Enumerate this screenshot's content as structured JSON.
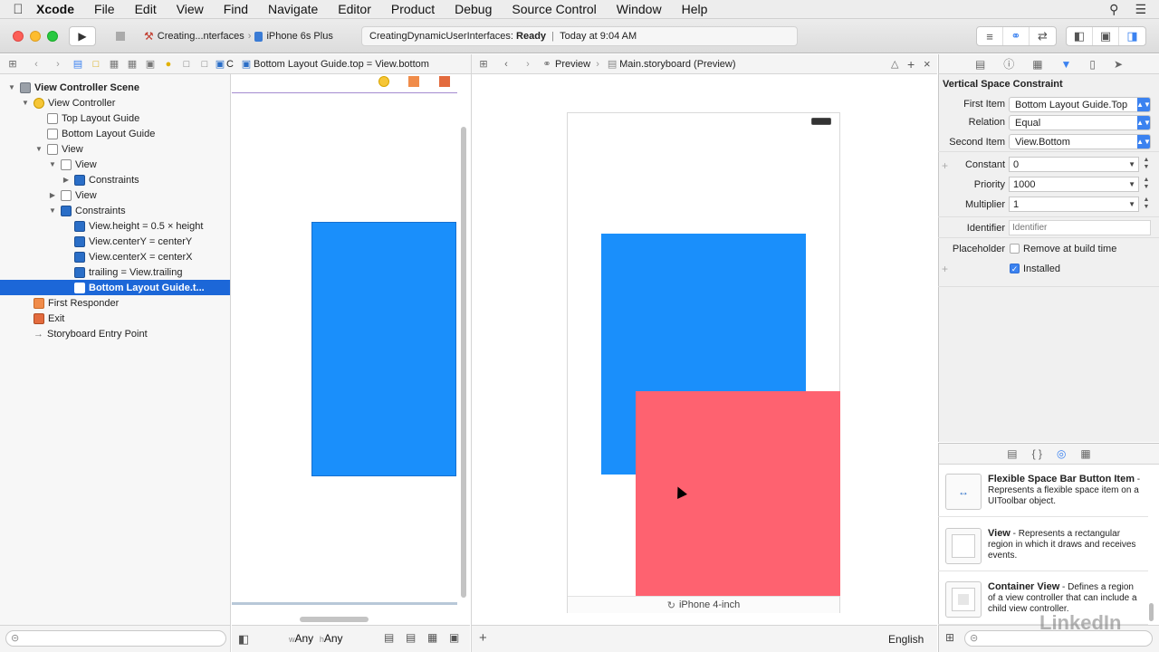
{
  "menubar": {
    "items": [
      "Xcode",
      "File",
      "Edit",
      "View",
      "Find",
      "Navigate",
      "Editor",
      "Product",
      "Debug",
      "Source Control",
      "Window",
      "Help"
    ]
  },
  "toolbar": {
    "scheme_project": "Creating...nterfaces",
    "scheme_device": "iPhone 6s Plus",
    "activity_project": "CreatingDynamicUserInterfaces:",
    "activity_status": "Ready",
    "activity_sep": "|",
    "activity_time": "Today at 9:04 AM"
  },
  "jumpbar": {
    "truncated": "C",
    "path": "Bottom Layout Guide.top = View.bottom"
  },
  "outline": {
    "rows": [
      {
        "label": "View Controller Scene",
        "indent": 0,
        "disc": "▼",
        "icon": "scene",
        "bold": true
      },
      {
        "label": "View Controller",
        "indent": 1,
        "disc": "▼",
        "icon": "vc"
      },
      {
        "label": "Top Layout Guide",
        "indent": 2,
        "disc": "",
        "icon": "plain"
      },
      {
        "label": "Bottom Layout Guide",
        "indent": 2,
        "disc": "",
        "icon": "plain"
      },
      {
        "label": "View",
        "indent": 2,
        "disc": "▼",
        "icon": "plain"
      },
      {
        "label": "View",
        "indent": 3,
        "disc": "▼",
        "icon": "plain"
      },
      {
        "label": "Constraints",
        "indent": 4,
        "disc": "▶",
        "icon": "con"
      },
      {
        "label": "View",
        "indent": 3,
        "disc": "▶",
        "icon": "plain"
      },
      {
        "label": "Constraints",
        "indent": 3,
        "disc": "▼",
        "icon": "con"
      },
      {
        "label": "View.height = 0.5 × height",
        "indent": 4,
        "disc": "",
        "icon": "con"
      },
      {
        "label": "View.centerY = centerY",
        "indent": 4,
        "disc": "",
        "icon": "con"
      },
      {
        "label": "View.centerX = centerX",
        "indent": 4,
        "disc": "",
        "icon": "con"
      },
      {
        "label": "trailing = View.trailing",
        "indent": 4,
        "disc": "",
        "icon": "con"
      },
      {
        "label": "Bottom Layout Guide.t...",
        "indent": 4,
        "disc": "",
        "icon": "con",
        "selected": true
      },
      {
        "label": "First Responder",
        "indent": 1,
        "disc": "",
        "icon": "fr"
      },
      {
        "label": "Exit",
        "indent": 1,
        "disc": "",
        "icon": "red"
      },
      {
        "label": "Storyboard Entry Point",
        "indent": 1,
        "disc": "",
        "icon": "arrow"
      }
    ]
  },
  "preview": {
    "breadcrumb_preview": "Preview",
    "breadcrumb_file": "Main.storyboard (Preview)",
    "device_label": "iPhone 4-inch",
    "language": "English"
  },
  "canvas_bottom": {
    "w_prefix": "w",
    "w_value": "Any",
    "h_prefix": "h",
    "h_value": "Any"
  },
  "inspector": {
    "title": "Vertical Space Constraint",
    "first_item_label": "First Item",
    "first_item_value": "Bottom Layout Guide.Top",
    "relation_label": "Relation",
    "relation_value": "Equal",
    "second_item_label": "Second Item",
    "second_item_value": "View.Bottom",
    "constant_label": "Constant",
    "constant_value": "0",
    "priority_label": "Priority",
    "priority_value": "1000",
    "multiplier_label": "Multiplier",
    "multiplier_value": "1",
    "identifier_label": "Identifier",
    "identifier_placeholder": "Identifier",
    "placeholder_label": "Placeholder",
    "placeholder_check": "Remove at build time",
    "installed_label": "Installed"
  },
  "library": {
    "items": [
      {
        "title": "Flexible Space Bar Button Item",
        "desc": " - Represents a flexible space item on a UIToolbar object."
      },
      {
        "title": "View",
        "desc": " - Represents a rectangular region in which it draws and receives events."
      },
      {
        "title": "Container View",
        "desc": " - Defines a region of a view controller that can include a child view controller."
      }
    ]
  },
  "watermark": "LinkedIn",
  "colors": {
    "blue_view": "#1a8ffb",
    "red_view": "#fe6270",
    "selection": "#1c67d8"
  }
}
